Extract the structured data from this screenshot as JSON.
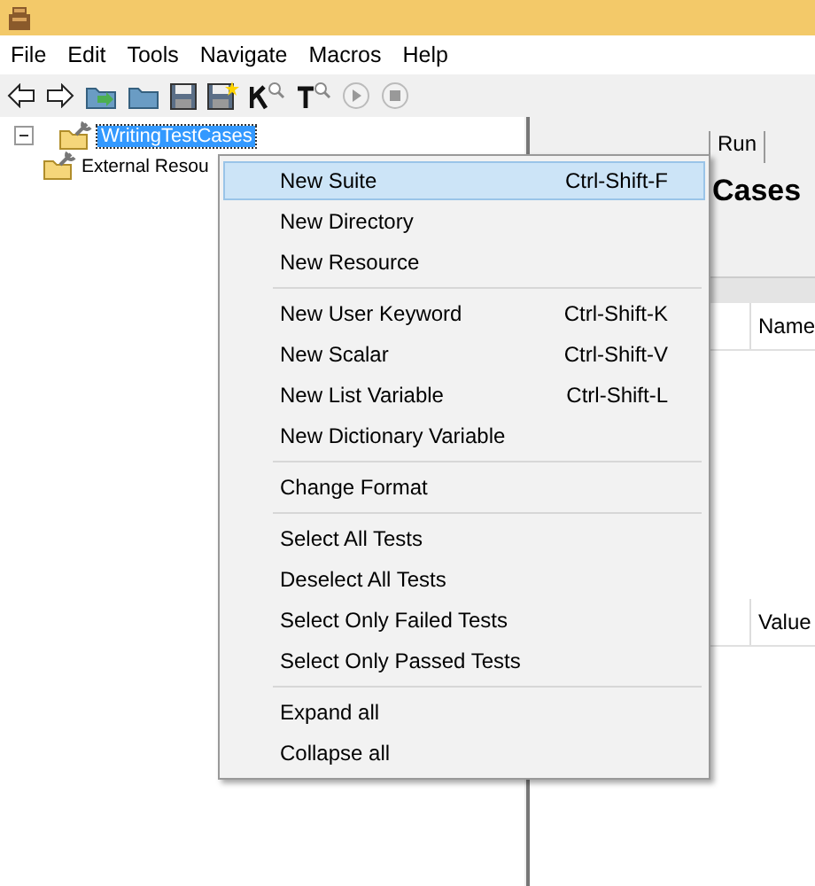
{
  "menu_bar": [
    "File",
    "Edit",
    "Tools",
    "Navigate",
    "Macros",
    "Help"
  ],
  "toolbar": [
    {
      "kind": "back"
    },
    {
      "kind": "forward"
    },
    {
      "kind": "open-suite"
    },
    {
      "kind": "open-dir"
    },
    {
      "kind": "save"
    },
    {
      "kind": "save-all"
    },
    {
      "kind": "keyword-search"
    },
    {
      "kind": "test-search"
    },
    {
      "kind": "play"
    },
    {
      "kind": "stop"
    }
  ],
  "tree": [
    {
      "label": "WritingTestCases",
      "selected": true,
      "expanded": true,
      "children": [
        {
          "label": "External Resou",
          "selected": false
        }
      ]
    }
  ],
  "right_panel": {
    "tabs": [
      {
        "label": "Run",
        "selected": false
      }
    ],
    "heading": "Cases",
    "table_headers": [
      "Name",
      "Value"
    ]
  },
  "context_menu": {
    "groups": [
      [
        {
          "label": "New Suite",
          "shortcut": "Ctrl-Shift-F",
          "selected": true
        },
        {
          "label": "New Directory",
          "selected": false
        },
        {
          "label": "New Resource",
          "selected": false
        }
      ],
      [
        {
          "label": "New User Keyword",
          "shortcut": "Ctrl-Shift-K",
          "selected": false
        },
        {
          "label": "New Scalar",
          "shortcut": "Ctrl-Shift-V",
          "selected": false
        },
        {
          "label": "New List Variable",
          "shortcut": "Ctrl-Shift-L",
          "selected": false
        },
        {
          "label": "New Dictionary Variable",
          "selected": false
        }
      ],
      [
        {
          "label": "Change Format",
          "selected": false
        }
      ],
      [
        {
          "label": "Select All Tests",
          "selected": false
        },
        {
          "label": "Deselect All Tests",
          "selected": false
        },
        {
          "label": "Select Only Failed Tests",
          "selected": false
        },
        {
          "label": "Select Only Passed Tests",
          "selected": false
        }
      ],
      [
        {
          "label": "Expand all",
          "selected": false
        },
        {
          "label": "Collapse all",
          "selected": false
        }
      ]
    ]
  }
}
